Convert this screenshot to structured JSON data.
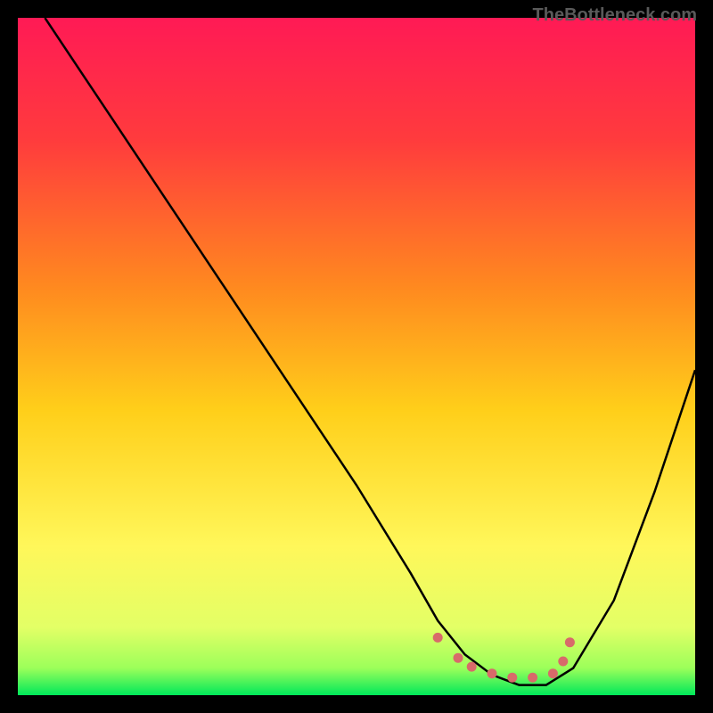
{
  "watermark": "TheBottleneck.com",
  "chart_data": {
    "type": "line",
    "title": "",
    "xlabel": "",
    "ylabel": "",
    "xlim": [
      0,
      100
    ],
    "ylim": [
      0,
      100
    ],
    "gradient_stops": [
      {
        "offset": 0,
        "color": "#ff1a55"
      },
      {
        "offset": 18,
        "color": "#ff3b3d"
      },
      {
        "offset": 40,
        "color": "#ff8a1f"
      },
      {
        "offset": 58,
        "color": "#ffcf1a"
      },
      {
        "offset": 78,
        "color": "#fff75a"
      },
      {
        "offset": 90,
        "color": "#e3ff66"
      },
      {
        "offset": 96,
        "color": "#9cff5a"
      },
      {
        "offset": 100,
        "color": "#00e85a"
      }
    ],
    "series": [
      {
        "name": "bottleneck-curve",
        "x": [
          4,
          10,
          20,
          30,
          40,
          50,
          58,
          62,
          66,
          70,
          74,
          78,
          82,
          88,
          94,
          100
        ],
        "y": [
          100,
          91,
          76,
          61,
          46,
          31,
          18,
          11,
          6,
          3,
          1.5,
          1.5,
          4,
          14,
          30,
          48
        ]
      }
    ],
    "markers": {
      "name": "optimal-zone",
      "color": "#d86a6a",
      "points": [
        {
          "x": 62,
          "y": 8.5
        },
        {
          "x": 65,
          "y": 5.5
        },
        {
          "x": 67,
          "y": 4.2
        },
        {
          "x": 70,
          "y": 3.2
        },
        {
          "x": 73,
          "y": 2.6
        },
        {
          "x": 76,
          "y": 2.6
        },
        {
          "x": 79,
          "y": 3.2
        },
        {
          "x": 80.5,
          "y": 5.0
        },
        {
          "x": 81.5,
          "y": 7.8
        }
      ]
    }
  }
}
